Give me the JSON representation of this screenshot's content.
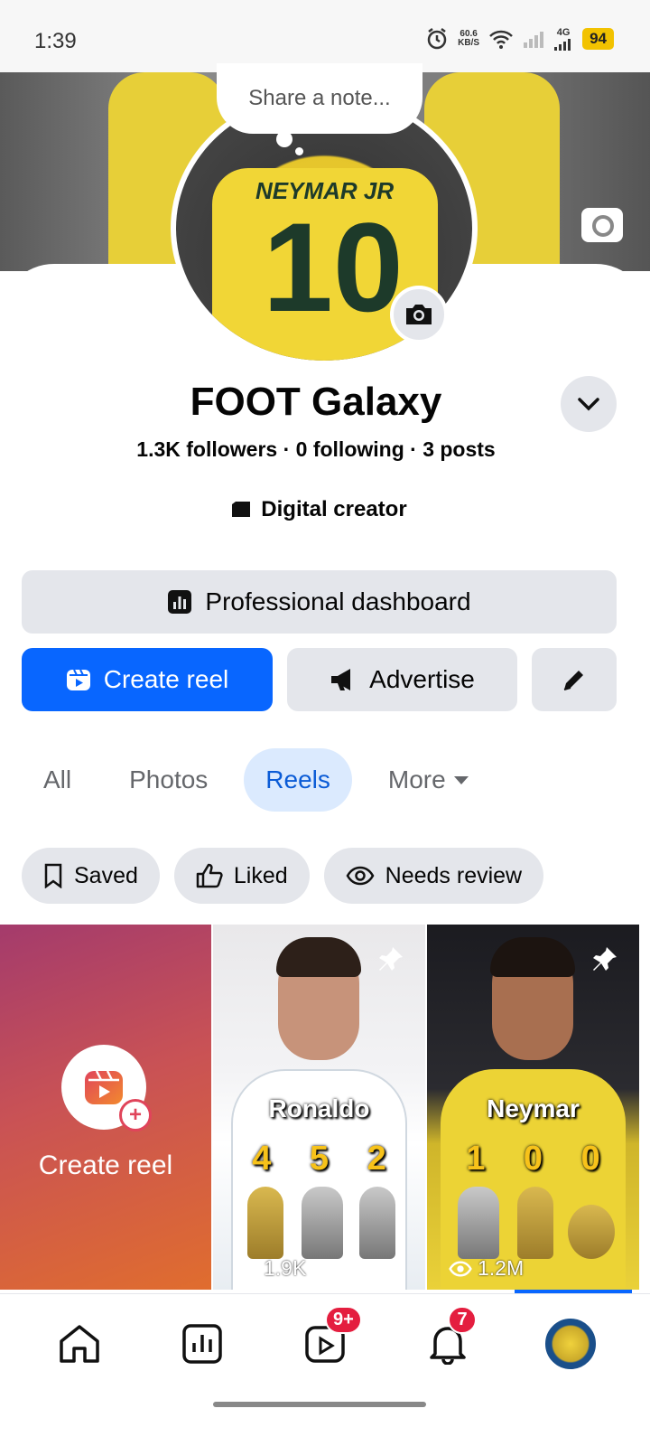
{
  "status_bar": {
    "time": "1:39",
    "net_speed_value": "60.6",
    "net_speed_unit": "KB/S",
    "network": "4G",
    "battery": "94"
  },
  "note": {
    "placeholder": "Share a note..."
  },
  "profile": {
    "name": "FOOT Galaxy",
    "stats": "1.3K followers · 0 following · 3 posts",
    "category": "Digital creator",
    "avatar_jersey_text": "NEYMAR JR",
    "avatar_jersey_number": "10"
  },
  "actions": {
    "dashboard": "Professional dashboard",
    "create_reel": "Create reel",
    "advertise": "Advertise"
  },
  "tabs": [
    {
      "label": "All"
    },
    {
      "label": "Photos"
    },
    {
      "label": "Reels",
      "active": true
    },
    {
      "label": "More"
    }
  ],
  "filters": [
    {
      "label": "Saved",
      "icon": "bookmark-icon"
    },
    {
      "label": "Liked",
      "icon": "thumbs-up-icon"
    },
    {
      "label": "Needs review",
      "icon": "eye-icon"
    }
  ],
  "reels": {
    "create_label": "Create reel",
    "items": [
      {
        "player": "Ronaldo",
        "stats": [
          "4",
          "5",
          "2"
        ],
        "views": "1.9K"
      },
      {
        "player": "Neymar",
        "stats": [
          "1",
          "0",
          "0"
        ],
        "views": "1.2M"
      }
    ]
  },
  "bottom_nav": {
    "reels_badge": "9+",
    "notifications_badge": "7"
  },
  "colors": {
    "accent": "#0866ff",
    "badge": "#e41e3f",
    "active_tab_bg": "#dbeafe"
  }
}
